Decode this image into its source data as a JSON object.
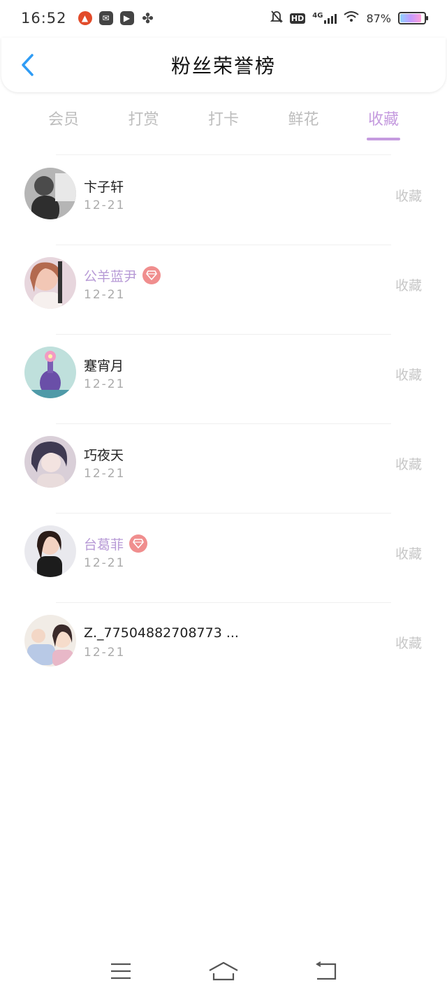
{
  "status_bar": {
    "time": "16:52",
    "network": "4G",
    "hd": "HD",
    "battery_text": "87%",
    "battery_level": 0.87,
    "app_icons": [
      "game-icon",
      "mail-icon",
      "video-icon",
      "fan-icon"
    ]
  },
  "header": {
    "title": "粉丝荣誉榜"
  },
  "tabs": [
    {
      "label": "会员",
      "active": false
    },
    {
      "label": "打赏",
      "active": false
    },
    {
      "label": "打卡",
      "active": false
    },
    {
      "label": "鲜花",
      "active": false
    },
    {
      "label": "收藏",
      "active": true
    }
  ],
  "colors": {
    "accent": "#c59bdf",
    "vip_name": "#b79ad6",
    "vip_badge": "#f08e8e",
    "back_arrow": "#2f9cf5",
    "muted": "#c7c7c7"
  },
  "fans": [
    {
      "name": "卞子轩",
      "date": "12-21",
      "action": "收藏",
      "vip": false
    },
    {
      "name": "公羊蓝尹",
      "date": "12-21",
      "action": "收藏",
      "vip": true
    },
    {
      "name": "蹇宵月",
      "date": "12-21",
      "action": "收藏",
      "vip": false
    },
    {
      "name": "巧夜天",
      "date": "12-21",
      "action": "收藏",
      "vip": false
    },
    {
      "name": "台葛菲",
      "date": "12-21",
      "action": "收藏",
      "vip": true
    },
    {
      "name": "Z._77504882708773 ...",
      "date": "12-21",
      "action": "收藏",
      "vip": false
    }
  ],
  "nav_bar": {
    "buttons": [
      "menu-icon",
      "home-icon",
      "back-icon"
    ]
  }
}
